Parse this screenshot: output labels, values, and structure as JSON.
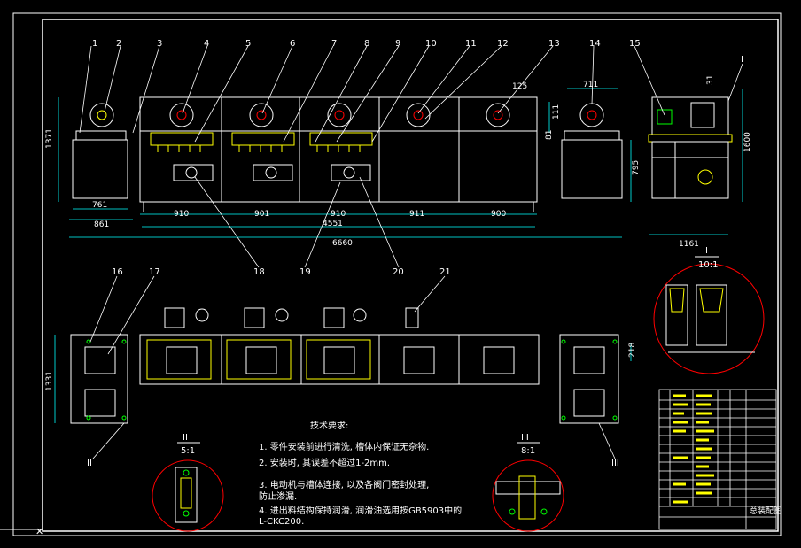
{
  "balloons": [
    "1",
    "2",
    "3",
    "4",
    "5",
    "6",
    "7",
    "8",
    "9",
    "10",
    "11",
    "12",
    "13",
    "14",
    "15",
    "I",
    "18",
    "19",
    "20",
    "21",
    "16",
    "17",
    "II",
    "III"
  ],
  "dims": {
    "front_height": "1371",
    "b1": "761",
    "b2": "861",
    "sections": [
      "910",
      "901",
      "910",
      "911",
      "900"
    ],
    "total_inner": "4551",
    "total": "6660",
    "d125": "125",
    "d711": "711",
    "d111": "111",
    "d81": "81",
    "d795": "795",
    "side_width": "1161",
    "side_height": "1600",
    "d31": "31",
    "plan_height": "1331",
    "d218": "218"
  },
  "details": {
    "I": {
      "label": "I",
      "scale": "10:1"
    },
    "II": {
      "label": "II",
      "scale": "5:1"
    },
    "III": {
      "label": "III",
      "scale": "8:1"
    }
  },
  "notes": {
    "title": "技术要求:",
    "items": [
      "1. 零件安装前进行清洗, 槽体内保证无杂物.",
      "2. 安装时, 其误差不超过1-2mm.",
      "3. 电动机与槽体连接, 以及各阀门密封处理,",
      "防止渗漏.",
      "4. 进出料结构保持润滑, 润滑油选用按GB5903中的",
      "L-CKC200."
    ]
  },
  "titleblock": {
    "name": "总装配图"
  },
  "colors": {
    "line": "#ffffff",
    "dim": "#00ffff",
    "part": "#ffff00",
    "detail": "#ff0000",
    "motor": "#00ff00"
  }
}
